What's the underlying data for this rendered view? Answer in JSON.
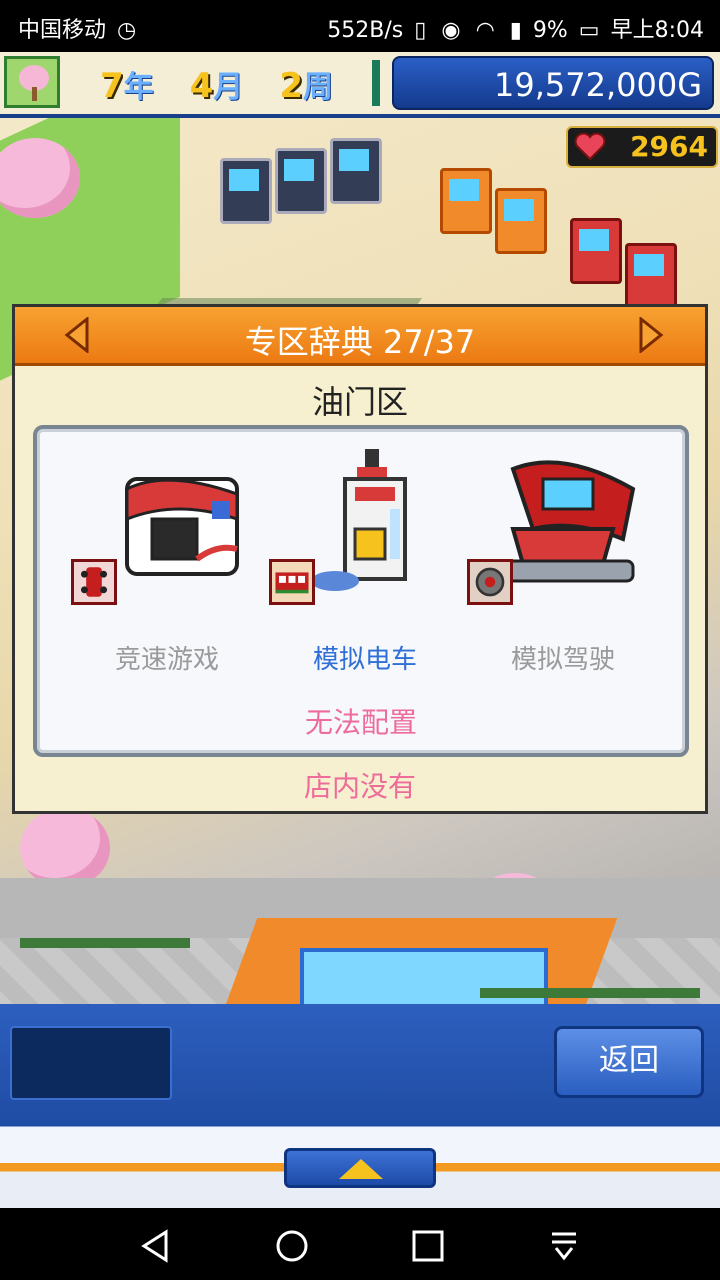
{
  "status_bar": {
    "carrier": "中国移动",
    "speed": "552B/s",
    "battery": "9%",
    "time": "早上8:04",
    "icons": [
      "alarm-icon",
      "vibrate-icon",
      "eye-icon",
      "wifi-icon",
      "signal-icon",
      "battery-icon"
    ]
  },
  "hud": {
    "year_num": "7",
    "year_unit": "年",
    "month_num": "4",
    "month_unit": "月",
    "week_num": "2",
    "week_unit": "周",
    "money": "19,572,000G",
    "hearts": "2964"
  },
  "dialog": {
    "title": "专区辞典 27/37",
    "subtitle": "油门区",
    "items": [
      {
        "label": "竞速游戏",
        "style": "gray",
        "icon": "race-car-cabinet"
      },
      {
        "label": "模拟电车",
        "style": "blue",
        "icon": "train-sim-cabinet"
      },
      {
        "label": "模拟驾驶",
        "style": "gray",
        "icon": "drive-sim-cabinet"
      }
    ],
    "placement_status": "无法配置",
    "store_status": "店内没有"
  },
  "controls": {
    "back_label": "返回"
  },
  "colors": {
    "accent_orange": "#ec7a12",
    "blue_text": "#2f6fd6",
    "pink_text": "#ee6c9a",
    "money_bg": "#2b5fc7"
  }
}
